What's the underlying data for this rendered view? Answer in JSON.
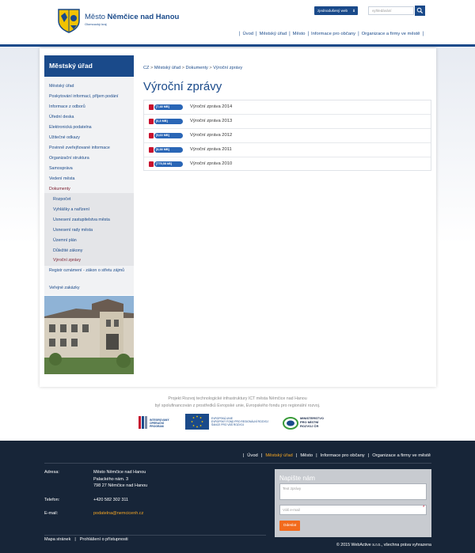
{
  "header": {
    "site_title_light": "Město",
    "site_title_bold": "Němčice nad Hanou",
    "site_subtitle": "Olomoucký kraj",
    "simple_web_label": "zjednodušený web",
    "search_placeholder": "vyhledávání",
    "nav": [
      "Úvod",
      "Městský úřad",
      "Město",
      "Informace pro občany",
      "Organizace a firmy ve městě"
    ]
  },
  "sidebar": {
    "heading": "Městský úřad",
    "items": [
      "Městský úřad",
      "Poskytování informací, příjem podání",
      "Informace z odborů",
      "Úřední deska",
      "Elektronická podatelna",
      "Užitečné odkazy",
      "Povinně zveřejňované informace",
      "Organizační struktura",
      "Samospráva",
      "Vedení města",
      "Dokumenty"
    ],
    "sub_items": [
      "Rozpočet",
      "Vyhlášky a nařízení",
      "Usnesení zastupitelstva města",
      "Usnesení rady města",
      "Územní plán",
      "Důležité zákony",
      "Výroční zprávy"
    ],
    "after_items": [
      "Registr oznámení - zákon o střetu zájmů",
      "Veřejné zakázky"
    ]
  },
  "breadcrumb": [
    "CZ",
    "Městský úřad",
    "Dokumenty",
    "Výroční zprávy"
  ],
  "page_title": "Výroční zprávy",
  "reports": [
    {
      "size": "[7,48 MB]",
      "label": "Výroční zpráva 2014"
    },
    {
      "size": "[6,3 MB]",
      "label": "Výroční zpráva 2013"
    },
    {
      "size": "[5,63 MB]",
      "label": "Výroční zpráva 2012"
    },
    {
      "size": "[8,38 MB]",
      "label": "Výroční zpráva 2011"
    },
    {
      "size": "[775,58 kB]",
      "label": "Výroční zpráva 2010"
    }
  ],
  "sponsor": {
    "line1": "Projekt Rozvoj technologické infrastruktury ICT města Němčice nad Hanou",
    "line2": "byl spolufinancován z prostředků Evropské unie, Evropského fondu pro regionální rozvoj.",
    "iop_text": "INTEGROVANÝ OPERAČNÍ PROGRAM",
    "eu_text": "EVROPSKÁ UNIE EVROPSKÝ FOND PRO REGIONÁLNÍ ROZVOJ ŠANCE PRO VÁŠ ROZVOJ",
    "mmr_text": "MINISTERSTVO PRO MÍSTNÍ ROZVOJ ČR"
  },
  "footer": {
    "nav": [
      "Úvod",
      "Městský úřad",
      "Město",
      "Informace pro občany",
      "Organizace a firmy ve městě"
    ],
    "address_label": "Adresa:",
    "address_lines": [
      "Město Němčice nad Hanou",
      "Palackého nám. 3",
      "798 27 Němčice nad Hanou"
    ],
    "phone_label": "Telefon:",
    "phone": "+420 582 302 311",
    "email_label": "E-mail:",
    "email": "podatelna@nemcicenh.cz",
    "form_title": "Napište nám",
    "form_text_placeholder": "Text zprávy",
    "form_email_placeholder": "Váš e-mail",
    "form_submit": "Odeslat",
    "bottom_links": [
      "Mapa stránek",
      "Prohlášení o přístupnosti"
    ],
    "copyright": "© 2015 WebActive s.r.o., všechna práva vyhrazena"
  },
  "colors": {
    "brand_blue": "#1a4a8a",
    "active_red": "#7a1a2b",
    "footer_bg": "#172538",
    "accent_orange": "#f5a623",
    "button_orange": "#f26b1d"
  }
}
